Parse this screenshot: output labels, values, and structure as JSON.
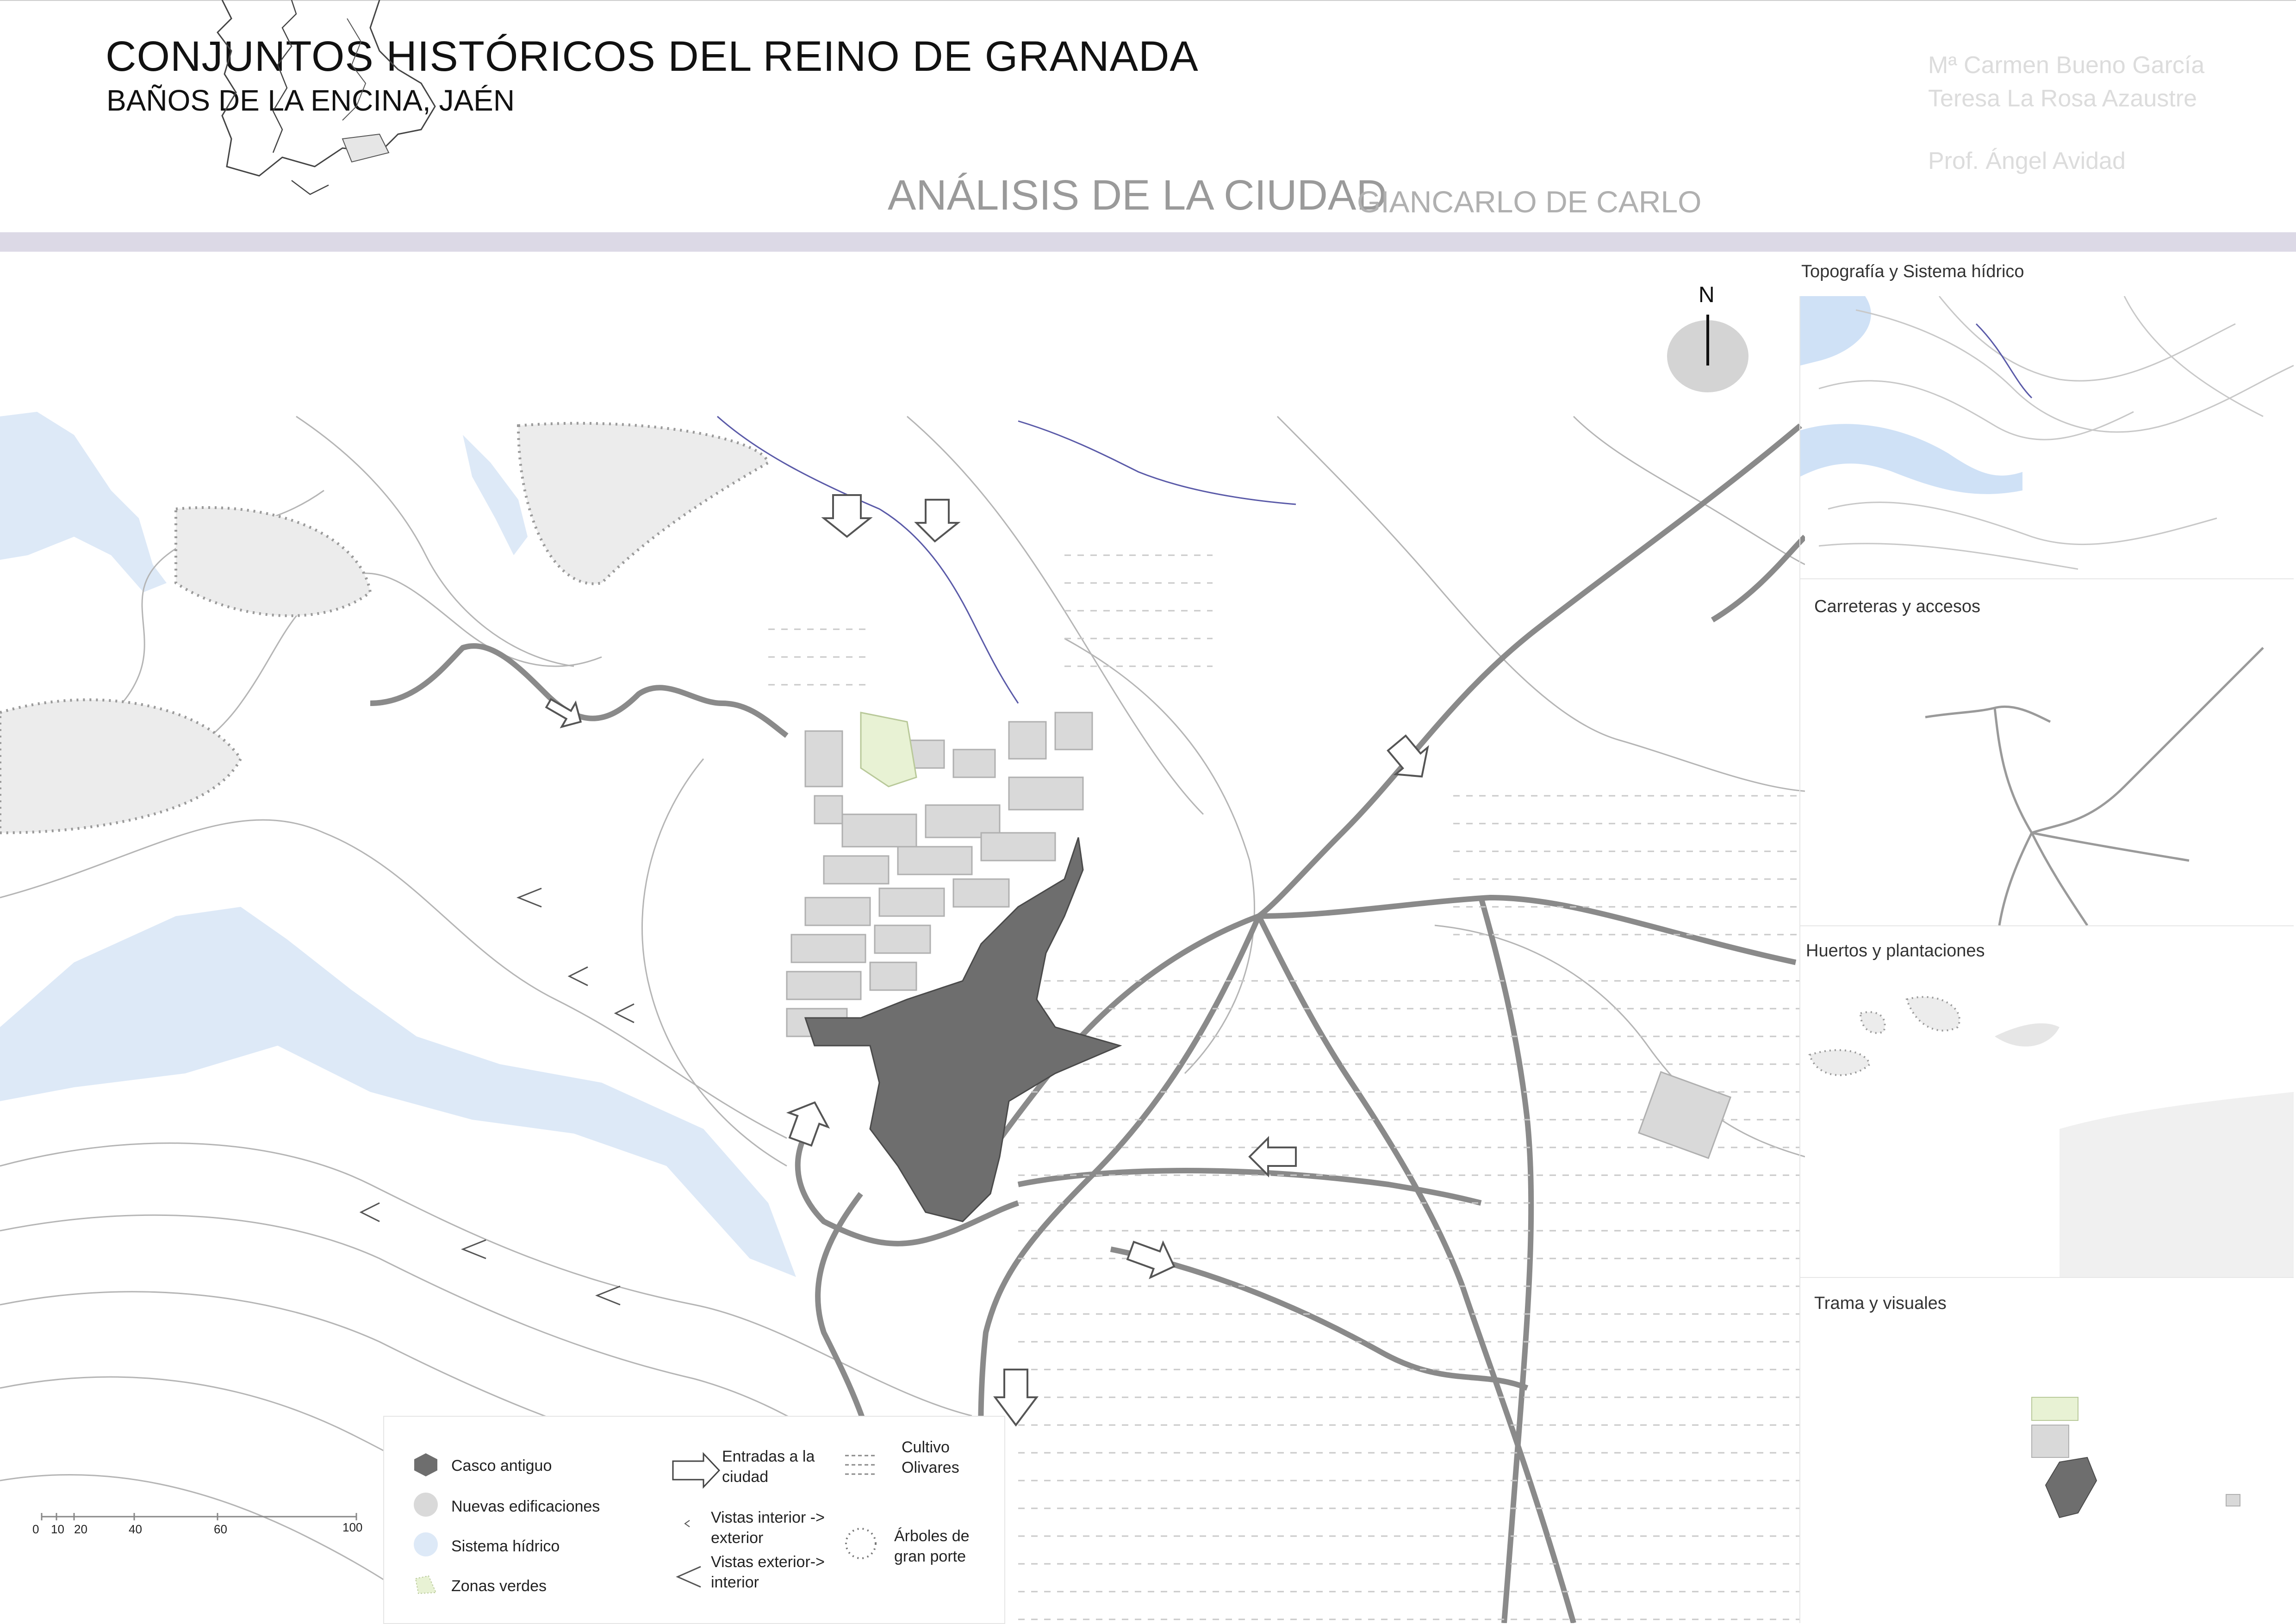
{
  "header": {
    "title": "CONJUNTOS HISTÓRICOS DEL REINO DE GRANADA",
    "subtitle": "BAÑOS DE LA ENCINA, JAÉN",
    "authors": [
      "Mª Carmen Bueno García",
      "Teresa La Rosa Azaustre"
    ],
    "professor": "Prof. Ángel Avidad",
    "analysis_title": "ANÁLISIS DE LA CIUDAD",
    "analysis_author": "GIANCARLO DE CARLO"
  },
  "north_label": "N",
  "panels": [
    {
      "title": "Topografía y Sistema hídrico"
    },
    {
      "title": "Carreteras y accesos"
    },
    {
      "title": "Huertos y plantaciones"
    },
    {
      "title": "Trama y visuales"
    }
  ],
  "legend": {
    "items": [
      {
        "label": "Casco antiguo"
      },
      {
        "label": "Nuevas edificaciones"
      },
      {
        "label": "Sistema hídrico"
      },
      {
        "label": "Zonas verdes"
      },
      {
        "label": "Entradas a la ciudad"
      },
      {
        "label": "Vistas interior -> exterior"
      },
      {
        "label": "Vistas exterior-> interior"
      },
      {
        "label": "Cultivo Olivares"
      },
      {
        "label": "Árboles de gran porte"
      }
    ]
  },
  "scale": {
    "ticks": [
      "0",
      "10",
      "20",
      "40",
      "60",
      "100"
    ]
  },
  "colors": {
    "casco_antiguo": "#6e6e6e",
    "nuevas_edificaciones": "#d9d9d9",
    "sistema_hidrico": "#dde9f7",
    "zonas_verdes": "#e8f2d4",
    "roads": "#8a8a8a",
    "rivers": "#5a5aa8",
    "header_band": "#dcd9e6"
  }
}
